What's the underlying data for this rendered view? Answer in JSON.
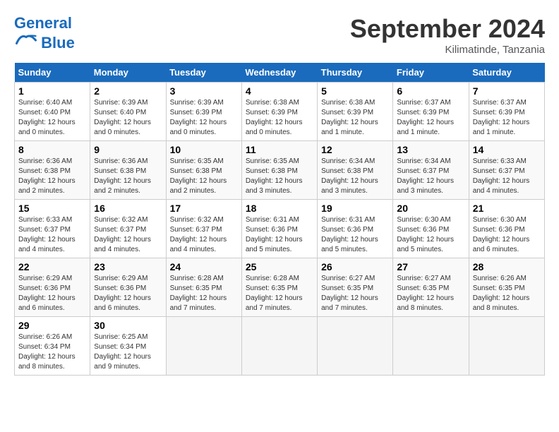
{
  "logo": {
    "text_general": "General",
    "text_blue": "Blue"
  },
  "title": "September 2024",
  "subtitle": "Kilimatinde, Tanzania",
  "days_of_week": [
    "Sunday",
    "Monday",
    "Tuesday",
    "Wednesday",
    "Thursday",
    "Friday",
    "Saturday"
  ],
  "weeks": [
    [
      {
        "day": "1",
        "sunrise": "6:40 AM",
        "sunset": "6:40 PM",
        "daylight": "12 hours and 0 minutes."
      },
      {
        "day": "2",
        "sunrise": "6:39 AM",
        "sunset": "6:40 PM",
        "daylight": "12 hours and 0 minutes."
      },
      {
        "day": "3",
        "sunrise": "6:39 AM",
        "sunset": "6:39 PM",
        "daylight": "12 hours and 0 minutes."
      },
      {
        "day": "4",
        "sunrise": "6:38 AM",
        "sunset": "6:39 PM",
        "daylight": "12 hours and 0 minutes."
      },
      {
        "day": "5",
        "sunrise": "6:38 AM",
        "sunset": "6:39 PM",
        "daylight": "12 hours and 1 minute."
      },
      {
        "day": "6",
        "sunrise": "6:37 AM",
        "sunset": "6:39 PM",
        "daylight": "12 hours and 1 minute."
      },
      {
        "day": "7",
        "sunrise": "6:37 AM",
        "sunset": "6:39 PM",
        "daylight": "12 hours and 1 minute."
      }
    ],
    [
      {
        "day": "8",
        "sunrise": "6:36 AM",
        "sunset": "6:38 PM",
        "daylight": "12 hours and 2 minutes."
      },
      {
        "day": "9",
        "sunrise": "6:36 AM",
        "sunset": "6:38 PM",
        "daylight": "12 hours and 2 minutes."
      },
      {
        "day": "10",
        "sunrise": "6:35 AM",
        "sunset": "6:38 PM",
        "daylight": "12 hours and 2 minutes."
      },
      {
        "day": "11",
        "sunrise": "6:35 AM",
        "sunset": "6:38 PM",
        "daylight": "12 hours and 3 minutes."
      },
      {
        "day": "12",
        "sunrise": "6:34 AM",
        "sunset": "6:38 PM",
        "daylight": "12 hours and 3 minutes."
      },
      {
        "day": "13",
        "sunrise": "6:34 AM",
        "sunset": "6:37 PM",
        "daylight": "12 hours and 3 minutes."
      },
      {
        "day": "14",
        "sunrise": "6:33 AM",
        "sunset": "6:37 PM",
        "daylight": "12 hours and 4 minutes."
      }
    ],
    [
      {
        "day": "15",
        "sunrise": "6:33 AM",
        "sunset": "6:37 PM",
        "daylight": "12 hours and 4 minutes."
      },
      {
        "day": "16",
        "sunrise": "6:32 AM",
        "sunset": "6:37 PM",
        "daylight": "12 hours and 4 minutes."
      },
      {
        "day": "17",
        "sunrise": "6:32 AM",
        "sunset": "6:37 PM",
        "daylight": "12 hours and 4 minutes."
      },
      {
        "day": "18",
        "sunrise": "6:31 AM",
        "sunset": "6:36 PM",
        "daylight": "12 hours and 5 minutes."
      },
      {
        "day": "19",
        "sunrise": "6:31 AM",
        "sunset": "6:36 PM",
        "daylight": "12 hours and 5 minutes."
      },
      {
        "day": "20",
        "sunrise": "6:30 AM",
        "sunset": "6:36 PM",
        "daylight": "12 hours and 5 minutes."
      },
      {
        "day": "21",
        "sunrise": "6:30 AM",
        "sunset": "6:36 PM",
        "daylight": "12 hours and 6 minutes."
      }
    ],
    [
      {
        "day": "22",
        "sunrise": "6:29 AM",
        "sunset": "6:36 PM",
        "daylight": "12 hours and 6 minutes."
      },
      {
        "day": "23",
        "sunrise": "6:29 AM",
        "sunset": "6:36 PM",
        "daylight": "12 hours and 6 minutes."
      },
      {
        "day": "24",
        "sunrise": "6:28 AM",
        "sunset": "6:35 PM",
        "daylight": "12 hours and 7 minutes."
      },
      {
        "day": "25",
        "sunrise": "6:28 AM",
        "sunset": "6:35 PM",
        "daylight": "12 hours and 7 minutes."
      },
      {
        "day": "26",
        "sunrise": "6:27 AM",
        "sunset": "6:35 PM",
        "daylight": "12 hours and 7 minutes."
      },
      {
        "day": "27",
        "sunrise": "6:27 AM",
        "sunset": "6:35 PM",
        "daylight": "12 hours and 8 minutes."
      },
      {
        "day": "28",
        "sunrise": "6:26 AM",
        "sunset": "6:35 PM",
        "daylight": "12 hours and 8 minutes."
      }
    ],
    [
      {
        "day": "29",
        "sunrise": "6:26 AM",
        "sunset": "6:34 PM",
        "daylight": "12 hours and 8 minutes."
      },
      {
        "day": "30",
        "sunrise": "6:25 AM",
        "sunset": "6:34 PM",
        "daylight": "12 hours and 9 minutes."
      },
      null,
      null,
      null,
      null,
      null
    ]
  ]
}
